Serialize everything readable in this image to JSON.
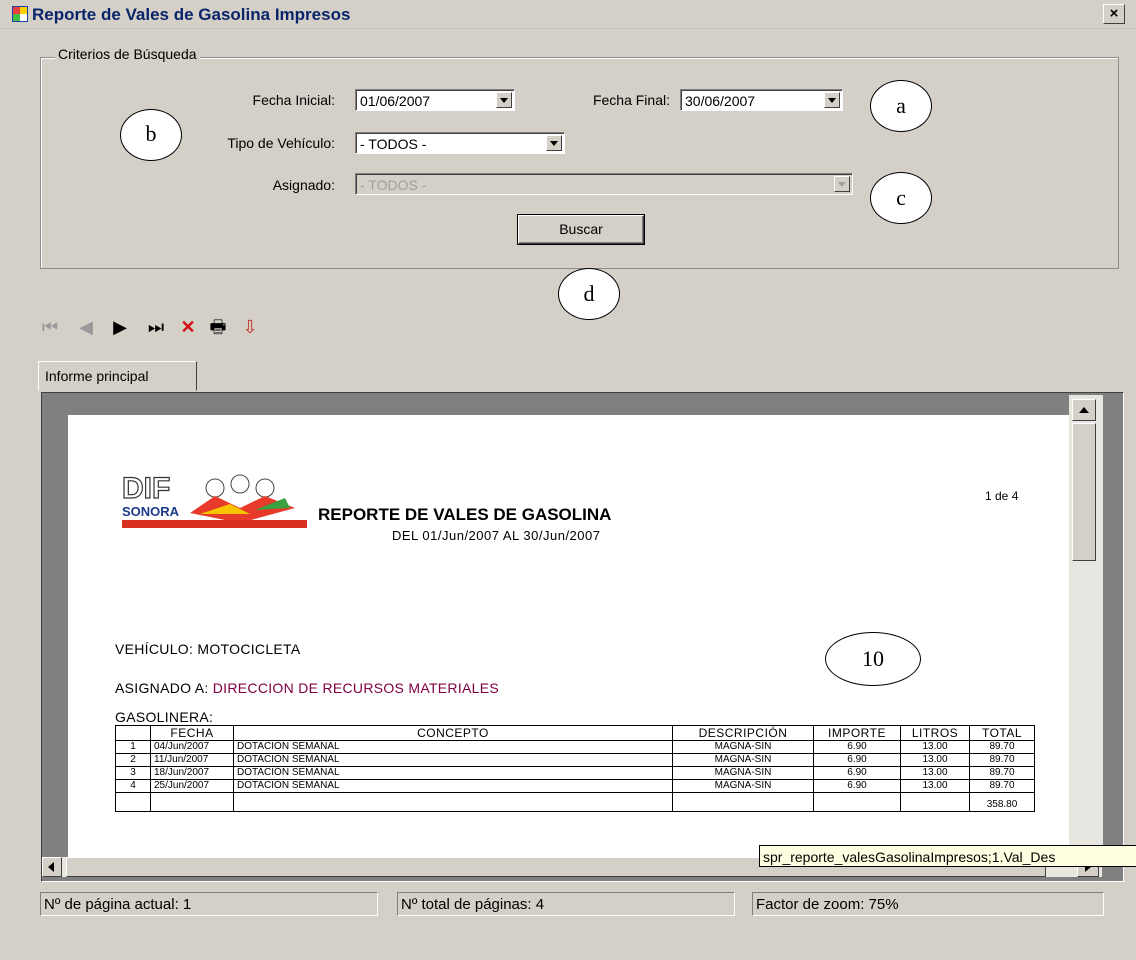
{
  "window": {
    "title": "Reporte de Vales de Gasolina Impresos",
    "close_glyph": "×",
    "icon": "app-window-icon"
  },
  "criteria": {
    "legend": "Criterios de Búsqueda",
    "fecha_inicial_label": "Fecha Inicial:",
    "fecha_inicial_value": "01/06/2007",
    "fecha_final_label": "Fecha Final:",
    "fecha_final_value": "30/06/2007",
    "tipo_vehiculo_label": "Tipo de Vehículo:",
    "tipo_vehiculo_value": "- TODOS -",
    "asignado_label": "Asignado:",
    "asignado_value": "- TODOS -",
    "buscar_label": "Buscar"
  },
  "callouts": {
    "a": "a",
    "b": "b",
    "c": "c",
    "d": "d",
    "ten": "10"
  },
  "toolbar": {
    "first": "⏮",
    "prev": "◀",
    "next": "▶",
    "last": "⏭",
    "stop": "✕",
    "print": "🖶",
    "export": "⇩",
    "icons": [
      "first-page-icon",
      "previous-page-icon",
      "next-page-icon",
      "last-page-icon",
      "stop-icon",
      "print-icon",
      "export-icon"
    ]
  },
  "tab": {
    "label": "Informe principal"
  },
  "report": {
    "logo_text": "SONORA",
    "page_indicator": "1 de 4",
    "title": "REPORTE DE VALES DE GASOLINA",
    "subtitle": "DEL 01/Jun/2007 AL 30/Jun/2007",
    "vehiculo_label": "VEHÍCULO:",
    "vehiculo_value": "MOTOCICLETA",
    "asignado_label": "ASIGNADO A:",
    "asignado_value": "DIRECCION  DE RECURSOS MATERIALES",
    "gasolinera_label": "GASOLINERA:",
    "columns": [
      "",
      "FECHA",
      "CONCEPTO",
      "DESCRIPCIÓN",
      "IMPORTE",
      "LITROS",
      "TOTAL"
    ],
    "rows": [
      [
        "1",
        "04/Jun/2007",
        "DOTACIÓN SEMANAL",
        "MAGNA-SIN",
        "6.90",
        "13.00",
        "89.70"
      ],
      [
        "2",
        "11/Jun/2007",
        "DOTACIÓN SEMANAL",
        "MAGNA-SIN",
        "6.90",
        "13.00",
        "89.70"
      ],
      [
        "3",
        "18/Jun/2007",
        "DOTACIÓN SEMANAL",
        "MAGNA-SIN",
        "6.90",
        "13.00",
        "89.70"
      ],
      [
        "4",
        "25/Jun/2007",
        "DOTACIÓN SEMANAL",
        "MAGNA-SIN",
        "6.90",
        "13.00",
        "89.70"
      ]
    ],
    "grand_total": "358.80",
    "accent_color": "#800040"
  },
  "tooltip": "spr_reporte_valesGasolinaImpresos;1.Val_Des",
  "status": {
    "current_page": "Nº de página actual: 1",
    "total_pages": "Nº total de páginas: 4",
    "zoom": "Factor de zoom: 75%"
  }
}
